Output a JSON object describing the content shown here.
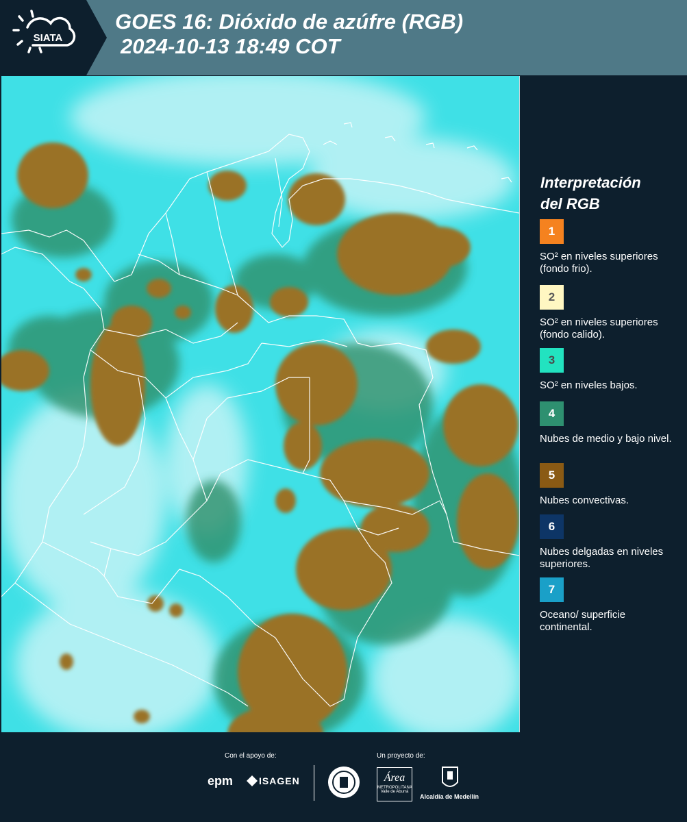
{
  "header": {
    "logo_text": "SIATA",
    "title_line1": "GOES 16: Dióxido de azúfre (RGB)",
    "title_line2": "2024-10-13 18:49 COT"
  },
  "legend": {
    "title_line1": "Interpretación",
    "title_line2": "del RGB",
    "items": [
      {
        "num": "1",
        "color": "#f5821f",
        "num_color": "#ffffff",
        "text": "SO² en niveles superiores (fondo frio)."
      },
      {
        "num": "2",
        "color": "#fff7c2",
        "num_color": "#5a5a5a",
        "text": "SO² en niveles superiores (fondo calido)."
      },
      {
        "num": "3",
        "color": "#22e3c0",
        "num_color": "#4a4a4a",
        "text": "SO² en niveles bajos."
      },
      {
        "num": "4",
        "color": "#2e9070",
        "num_color": "#ffffff",
        "text": "Nubes de medio y bajo nivel."
      },
      {
        "num": "5",
        "color": "#8a5a14",
        "num_color": "#ffffff",
        "text": "Nubes convectivas."
      },
      {
        "num": "6",
        "color": "#0d3566",
        "num_color": "#ffffff",
        "text": "Nubes delgadas en niveles superiores."
      },
      {
        "num": "7",
        "color": "#1aa0c8",
        "num_color": "#ffffff",
        "text": "Oceano/ superficie continental."
      }
    ]
  },
  "footer": {
    "support_label": "Con el apoyo de:",
    "project_label": "Un proyecto de:",
    "epm": "epm",
    "isagen": "ISAGEN",
    "area_line1": "Área",
    "area_line2": "METROPOLITANA",
    "area_line3": "Valle de Aburrá",
    "alcaldia": "Alcaldía de Medellín"
  },
  "map_colors": {
    "base": "#3fe0e6",
    "haze": "#d6f6f8",
    "low_cloud": "#2f8f6a",
    "convective": "#9a7226",
    "border": "#ffffff"
  }
}
